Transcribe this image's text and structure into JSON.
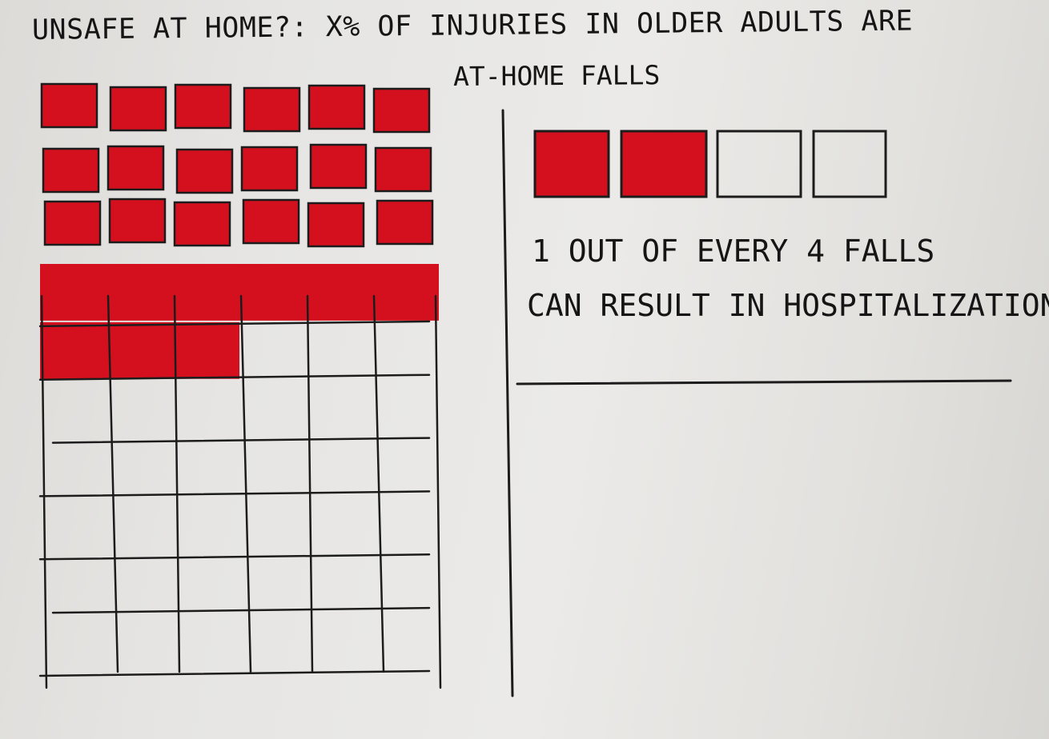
{
  "title": {
    "line1": "UNSAFE AT HOME?: X% OF INJURIES IN OLDER ADULTS ARE",
    "line2": "AT-HOME FALLS"
  },
  "waffle": {
    "rows": 10,
    "cols": 6,
    "filled_count": 27,
    "fill_color": "#d4101e",
    "line_color": "#1c1c1c"
  },
  "falls_figure": {
    "total_boxes": 4,
    "filled_boxes": 2,
    "caption_line1": "1 OUT OF EVERY 4 FALLS",
    "caption_line2": "CAN RESULT IN HOSPITALIZATION"
  },
  "colors": {
    "paper": "#e8e7e5",
    "ink": "#151515",
    "marker_red": "#d4101e"
  }
}
